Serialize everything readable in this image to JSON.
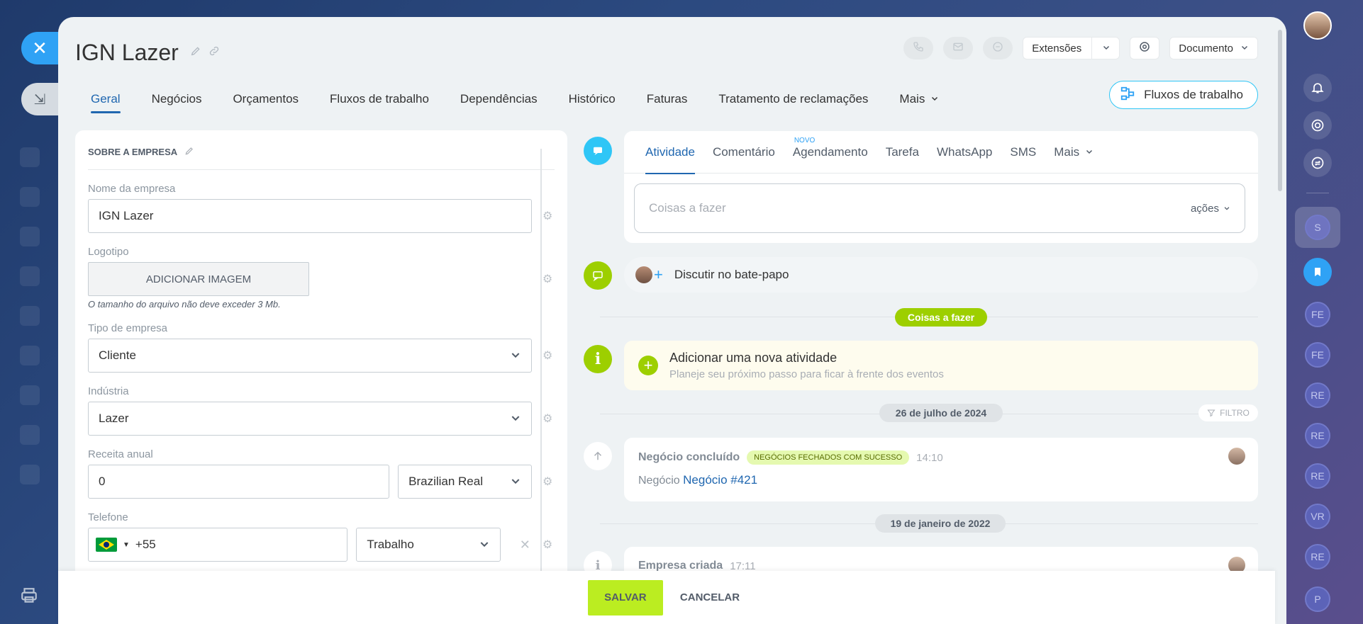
{
  "company_title": "IGN Lazer",
  "header": {
    "extensions_label": "Extensões",
    "document_label": "Documento"
  },
  "tabs": [
    "Geral",
    "Negócios",
    "Orçamentos",
    "Fluxos de trabalho",
    "Dependências",
    "Histórico",
    "Faturas",
    "Tratamento de reclamações",
    "Mais"
  ],
  "workflows_button": "Fluxos de trabalho",
  "about": {
    "section_title": "SOBRE A EMPRESA",
    "name_label": "Nome da empresa",
    "name_value": "IGN Lazer",
    "logo_label": "Logotipo",
    "add_image_label": "ADICIONAR IMAGEM",
    "file_hint": "O tamanho do arquivo não deve exceder 3 Mb.",
    "type_label": "Tipo de empresa",
    "type_value": "Cliente",
    "industry_label": "Indústria",
    "industry_value": "Lazer",
    "revenue_label": "Receita anual",
    "revenue_value": "0",
    "currency_value": "Brazilian Real",
    "phone_label": "Telefone",
    "phone_code": "+55",
    "phone_type": "Trabalho"
  },
  "activity": {
    "tabs": [
      "Atividade",
      "Comentário",
      "Agendamento",
      "Tarefa",
      "WhatsApp",
      "SMS",
      "Mais"
    ],
    "new_badge": "NOVO",
    "todo_placeholder": "Coisas a fazer",
    "actions_label": "ações",
    "chat_label": "Discutir no bate-papo",
    "todo_badge": "Coisas a fazer",
    "new_activity_title": "Adicionar uma nova atividade",
    "new_activity_sub": "Planeje seu próximo passo para ficar à frente dos eventos",
    "date1": "26 de julho de 2024",
    "filter_label": "FILTRO",
    "event1_title": "Negócio concluído",
    "event1_badge": "NEGÓCIOS FECHADOS COM SUCESSO",
    "event1_time": "14:10",
    "event1_prefix": "Negócio",
    "event1_link": "Negócio #421",
    "date2": "19 de janeiro de 2022",
    "event2_title": "Empresa criada",
    "event2_time": "17:11"
  },
  "footer": {
    "save": "SALVAR",
    "cancel": "CANCELAR"
  },
  "rail_letters": [
    "S",
    "FE",
    "FE",
    "RE",
    "RE",
    "RE",
    "VR",
    "RE",
    "P"
  ],
  "colors": {
    "accent_blue": "#2067b0",
    "lime": "#bbed21",
    "green": "#9dcf00",
    "cyan": "#2fc6f6"
  }
}
